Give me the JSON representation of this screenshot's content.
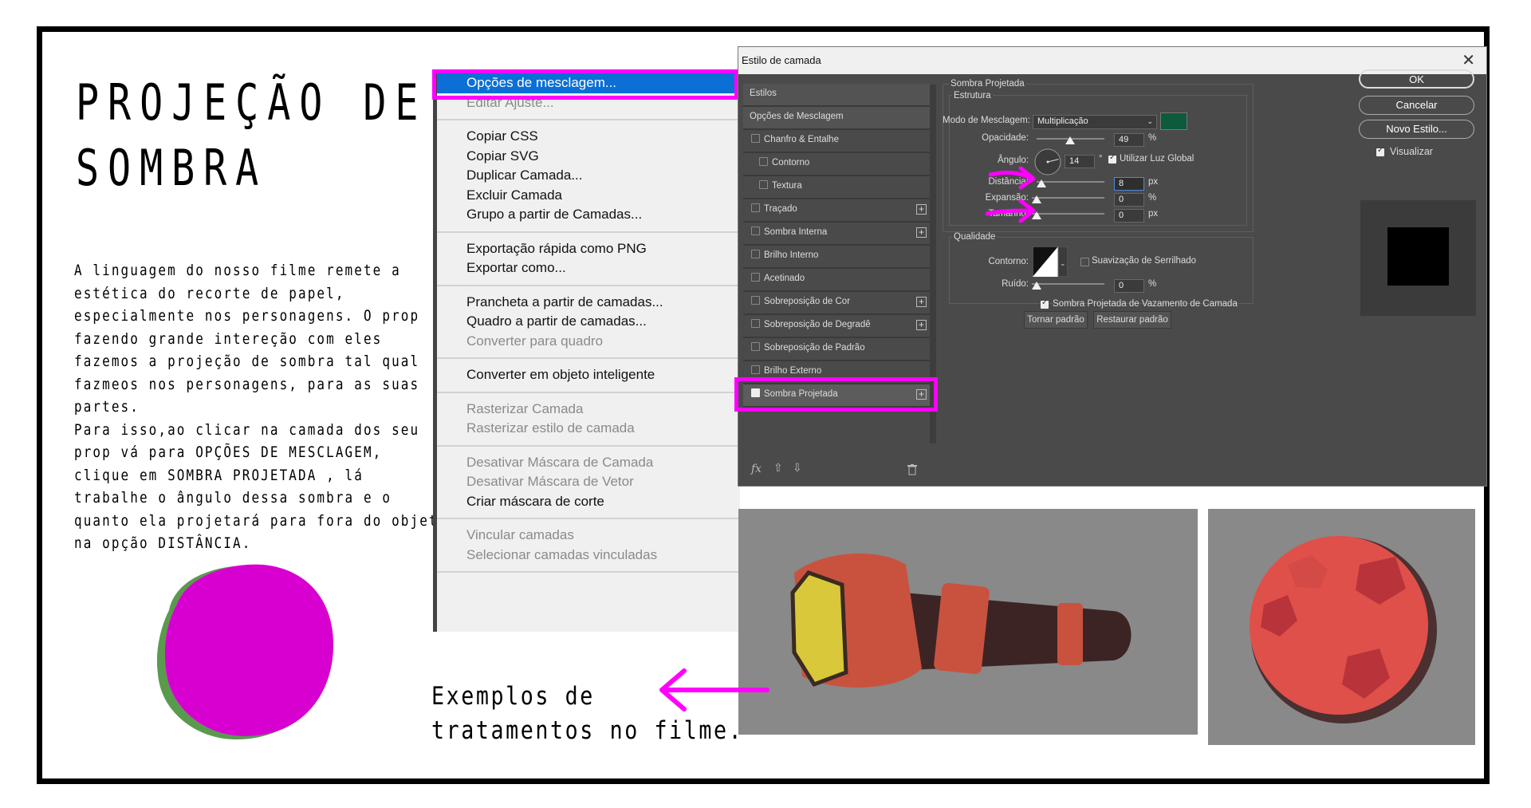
{
  "slide": {
    "title_lines": [
      "PROJEÇÃO DE",
      "SOMBRA"
    ],
    "body_lines": [
      "A linguagem do nosso filme remete a",
      "estética do recorte de papel,",
      "especialmente nos personagens. O prop",
      "fazendo grande intereção com eles",
      "fazemos a projeção de sombra tal qual",
      "fazmeos nos personagens, para as suas",
      "partes.",
      "Para isso,ao clicar na camada dos seu",
      "prop vá para OPÇÕES DE MESCLAGEM,",
      "clique em SOMBRA PROJETADA , lá",
      "trabalhe o ângulo dessa sombra e o",
      "quanto ela projetará para fora do objeto,",
      "na opção DISTÂNCIA."
    ],
    "caption_lines": [
      "Exemplos de",
      "tratamentos no filme."
    ],
    "highlight_color": "#ff00ff"
  },
  "context_menu": {
    "groups": [
      [
        {
          "label": "Opções de mesclagem...",
          "state": "selected"
        },
        {
          "label": "Editar Ajuste...",
          "state": "disabled"
        }
      ],
      [
        {
          "label": "Copiar CSS",
          "state": "normal"
        },
        {
          "label": "Copiar SVG",
          "state": "normal"
        },
        {
          "label": "Duplicar Camada...",
          "state": "normal"
        },
        {
          "label": "Excluir Camada",
          "state": "normal"
        },
        {
          "label": "Grupo a partir de Camadas...",
          "state": "normal"
        }
      ],
      [
        {
          "label": "Exportação rápida como PNG",
          "state": "normal"
        },
        {
          "label": "Exportar como...",
          "state": "normal"
        }
      ],
      [
        {
          "label": "Prancheta a partir de camadas...",
          "state": "normal"
        },
        {
          "label": "Quadro a partir de camadas...",
          "state": "normal"
        },
        {
          "label": "Converter para quadro",
          "state": "disabled"
        }
      ],
      [
        {
          "label": "Converter em objeto inteligente",
          "state": "normal"
        }
      ],
      [
        {
          "label": "Rasterizar Camada",
          "state": "disabled"
        },
        {
          "label": "Rasterizar estilo de camada",
          "state": "disabled"
        }
      ],
      [
        {
          "label": "Desativar Máscara de Camada",
          "state": "disabled"
        },
        {
          "label": "Desativar Máscara de Vetor",
          "state": "disabled"
        },
        {
          "label": "Criar máscara de corte",
          "state": "normal"
        }
      ],
      [
        {
          "label": "Vincular camadas",
          "state": "disabled"
        },
        {
          "label": "Selecionar camadas vinculadas",
          "state": "disabled"
        }
      ]
    ]
  },
  "dialog": {
    "title": "Estilo de camada",
    "close_glyph": "✕",
    "styles_header": "Estilos",
    "blend_options": "Opções de Mesclagem",
    "styles": [
      {
        "label": "Chanfro & Entalhe",
        "checked": false,
        "plus": false,
        "indent": false
      },
      {
        "label": "Contorno",
        "checked": false,
        "plus": false,
        "indent": true
      },
      {
        "label": "Textura",
        "checked": false,
        "plus": false,
        "indent": true
      },
      {
        "label": "Traçado",
        "checked": false,
        "plus": true,
        "indent": false
      },
      {
        "label": "Sombra Interna",
        "checked": false,
        "plus": true,
        "indent": false
      },
      {
        "label": "Brilho Interno",
        "checked": false,
        "plus": false,
        "indent": false
      },
      {
        "label": "Acetinado",
        "checked": false,
        "plus": false,
        "indent": false
      },
      {
        "label": "Sobreposição de Cor",
        "checked": false,
        "plus": true,
        "indent": false
      },
      {
        "label": "Sobreposição de Degradê",
        "checked": false,
        "plus": true,
        "indent": false
      },
      {
        "label": "Sobreposição de Padrão",
        "checked": false,
        "plus": false,
        "indent": false
      },
      {
        "label": "Brilho Externo",
        "checked": false,
        "plus": false,
        "indent": false
      },
      {
        "label": "Sombra Projetada",
        "checked": true,
        "plus": true,
        "indent": false
      }
    ],
    "footer_fx": "fx",
    "section_title": "Sombra Projetada",
    "structure_label": "Estrutura",
    "blend_mode_label": "Modo de Mesclagem:",
    "blend_mode_value": "Multiplicação",
    "shadow_color": "#0e5a3c",
    "opacity_label": "Opacidade:",
    "opacity_value": "49",
    "opacity_fraction": 0.49,
    "percent_unit": "%",
    "angle_label": "Ângulo:",
    "angle_value": "14",
    "degree_unit": "°",
    "global_light_label": "Utilizar Luz Global",
    "distance_label": "Distância:",
    "distance_value": "8",
    "px_unit": "px",
    "spread_label": "Expansão:",
    "spread_value": "0",
    "size_label": "Tamanho:",
    "size_value": "0",
    "quality_label": "Qualidade",
    "contour_label": "Contorno:",
    "antialias_label": "Suavização de Serrilhado",
    "noise_label": "Ruído:",
    "noise_value": "0",
    "knockout_label": "Sombra Projetada de Vazamento de Camada",
    "make_default": "Tornar padrão",
    "reset_default": "Restaurar padrão",
    "ok": "OK",
    "cancel": "Cancelar",
    "new_style": "Novo Estilo...",
    "preview_label": "Visualizar"
  }
}
